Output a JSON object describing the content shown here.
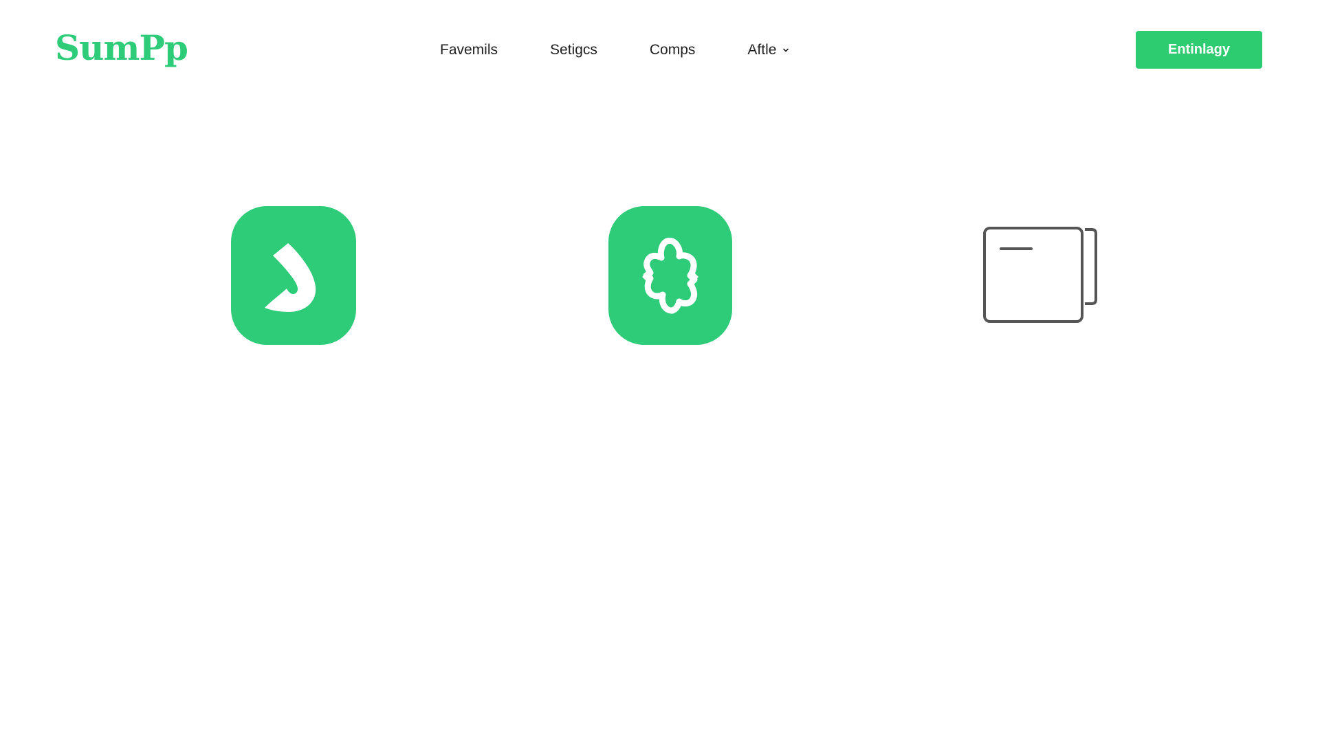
{
  "header": {
    "logo_text": "SumPp",
    "nav": [
      {
        "label": "Favemils"
      },
      {
        "label": "Setigcs"
      },
      {
        "label": "Comps"
      },
      {
        "label": "Aftle",
        "has_dropdown": true
      }
    ],
    "cta_label": "Entinlagy"
  },
  "tiles": [
    {
      "icon": "s-swoosh-icon"
    },
    {
      "icon": "sync-puzzle-icon"
    },
    {
      "icon": "window-stack-icon"
    }
  ],
  "colors": {
    "brand_green": "#2ecc78",
    "button_green": "#2ecc71",
    "text_dark": "#222222",
    "outline_gray": "#555555"
  }
}
